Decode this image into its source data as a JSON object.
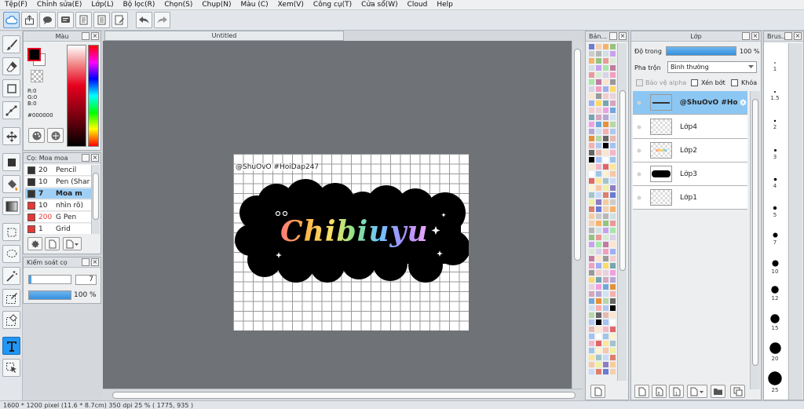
{
  "menu": [
    "Tệp(F)",
    "Chỉnh sửa(E)",
    "Lớp(L)",
    "Bộ lọc(R)",
    "Chọn(S)",
    "Chụp(N)",
    "Màu (C)",
    "Xem(V)",
    "Công cụ(T)",
    "Cửa sổ(W)",
    "Cloud",
    "Help"
  ],
  "document": {
    "tab_title": "Untitled",
    "watermark": "@ShuOvO #HoiDap247",
    "art_text": "Chibiuyu"
  },
  "color_panel": {
    "title": "Màu",
    "r": "R:0",
    "g": "G:0",
    "b": "B:0",
    "hex": "#000000",
    "colors": {
      "fg": "#000000",
      "bg": "#ffffff",
      "accent": "#e6001e"
    }
  },
  "brush_panel": {
    "title": "Cọ: Moa moa",
    "brushes": [
      {
        "size": "20",
        "name": "Pencil",
        "color": "#333333"
      },
      {
        "size": "10",
        "name": "Pen (Shar",
        "color": "#333333"
      },
      {
        "size": "7",
        "name": "Moa m",
        "color": "#333333"
      },
      {
        "size": "10",
        "name": "nhìn rõ)",
        "color": "#e53935"
      },
      {
        "size": "200",
        "name": "G Pen",
        "color": "#e53935"
      },
      {
        "size": "1",
        "name": "Grid",
        "color": "#e53935"
      }
    ]
  },
  "brush_control": {
    "title": "Kiểm soát cọ",
    "size": "7",
    "opacity": "100 %",
    "opacity_fraction": 1.0
  },
  "palette_panel": {
    "title": "Bản..."
  },
  "layer_panel": {
    "title": "Lớp",
    "opacity_label": "Độ trong",
    "opacity_value": "100 %",
    "opacity_fraction": 1.0,
    "blend_label": "Pha trộn",
    "blend_value": "Bình thường",
    "protect_alpha": "Bảo vệ alpha",
    "clipping": "Xén bớt",
    "lock": "Khóa",
    "layers": [
      {
        "name": "@ShuOvO #Ho",
        "selected": true
      },
      {
        "name": "Lớp4",
        "selected": false
      },
      {
        "name": "Lớp2",
        "selected": false
      },
      {
        "name": "Lớp3",
        "selected": false
      },
      {
        "name": "Lớp1",
        "selected": false
      }
    ]
  },
  "brush_size_panel": {
    "title": "Brus...",
    "sizes": [
      "1",
      "1.5",
      "2",
      "3",
      "4",
      "5",
      "7",
      "10",
      "12",
      "15",
      "20",
      "25"
    ]
  },
  "status": "1600 * 1200 pixel  (11.6 * 8.7cm)  350 dpi  25 %  ( 1775, 935 )"
}
